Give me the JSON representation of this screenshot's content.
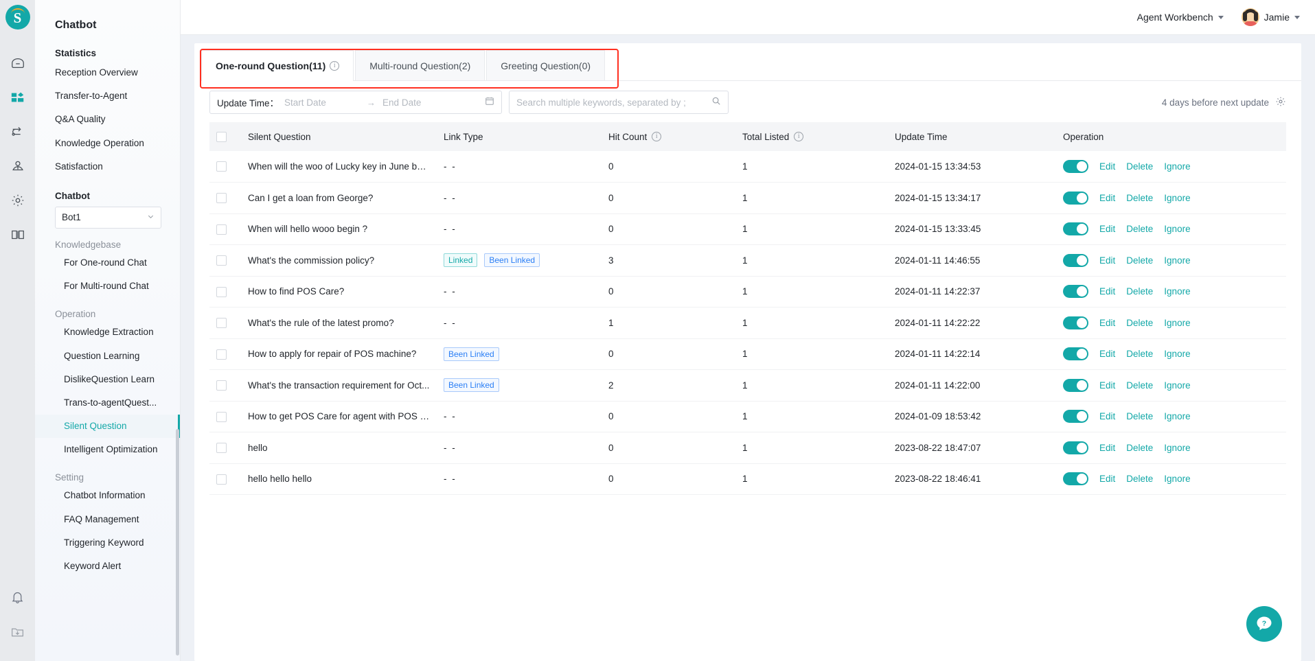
{
  "brand": {
    "logo_letter": "S",
    "accent": "#13a8a8",
    "highlight": "#ff2f20"
  },
  "topbar": {
    "workbench_label": "Agent Workbench",
    "user_name": "Jamie"
  },
  "sidebar": {
    "title": "Chatbot",
    "groups": [
      {
        "label": "Statistics",
        "style": "bold",
        "items": [
          "Reception Overview",
          "Transfer-to-Agent",
          "Q&A Quality",
          "Knowledge Operation",
          "Satisfaction"
        ]
      },
      {
        "label": "Chatbot",
        "style": "bold",
        "select_value": "Bot1",
        "items": []
      },
      {
        "label": "Knowledgebase",
        "style": "muted",
        "items": [
          "For One-round Chat",
          "For Multi-round Chat"
        ]
      },
      {
        "label": "Operation",
        "style": "muted",
        "items": [
          "Knowledge Extraction",
          "Question Learning",
          "DislikeQuestion Learn",
          "Trans-to-agentQuest...",
          "Silent Question",
          "Intelligent Optimization"
        ]
      },
      {
        "label": "Setting",
        "style": "muted",
        "items": [
          "Chatbot Information",
          "FAQ Management",
          "Triggering Keyword",
          "Keyword Alert"
        ]
      }
    ],
    "active_item": "Silent Question"
  },
  "rail_icons": [
    "home-icon",
    "dashboard-icon",
    "transfer-icon",
    "agent-icon",
    "settings-icon",
    "knowledge-book-icon",
    "bell-icon",
    "download-icon"
  ],
  "tabs": [
    {
      "label": "One-round Question(11)",
      "active": true,
      "has_info": true
    },
    {
      "label": "Multi-round Question(2)",
      "active": false,
      "has_info": false
    },
    {
      "label": "Greeting Question(0)",
      "active": false,
      "has_info": false
    }
  ],
  "filters": {
    "update_time_label": "Update Time：",
    "start_date_placeholder": "Start Date",
    "end_date_placeholder": "End Date",
    "range_separator": "→",
    "search_placeholder": "Search multiple keywords, separated by ;",
    "update_note": "4 days before next update"
  },
  "table": {
    "columns": [
      {
        "key": "checkbox",
        "label": ""
      },
      {
        "key": "question",
        "label": "Silent Question",
        "info": false
      },
      {
        "key": "link_type",
        "label": "Link Type",
        "info": false
      },
      {
        "key": "hit_count",
        "label": "Hit Count",
        "info": true
      },
      {
        "key": "total_listed",
        "label": "Total Listed",
        "info": true
      },
      {
        "key": "update_time",
        "label": "Update Time",
        "info": false
      },
      {
        "key": "operation",
        "label": "Operation",
        "info": false
      }
    ],
    "no_link_placeholder": "- -",
    "ops": {
      "edit": "Edit",
      "delete": "Delete",
      "ignore": "Ignore"
    },
    "rows": [
      {
        "question": "When will the woo of Lucky key in June be ...",
        "tags": [],
        "hit_count": "0",
        "total_listed": "1",
        "update_time": "2024-01-15 13:34:53",
        "enabled": true
      },
      {
        "question": "Can I get a loan from George?",
        "tags": [],
        "hit_count": "0",
        "total_listed": "1",
        "update_time": "2024-01-15 13:34:17",
        "enabled": true
      },
      {
        "question": "When will hello wooo begin ?",
        "tags": [],
        "hit_count": "0",
        "total_listed": "1",
        "update_time": "2024-01-15 13:33:45",
        "enabled": true
      },
      {
        "question": "What's the commission policy?",
        "tags": [
          "Linked",
          "Been Linked"
        ],
        "hit_count": "3",
        "total_listed": "1",
        "update_time": "2024-01-11 14:46:55",
        "enabled": true
      },
      {
        "question": "How to find POS Care?",
        "tags": [],
        "hit_count": "0",
        "total_listed": "1",
        "update_time": "2024-01-11 14:22:37",
        "enabled": true
      },
      {
        "question": "What's the rule of the latest promo?",
        "tags": [],
        "hit_count": "1",
        "total_listed": "1",
        "update_time": "2024-01-11 14:22:22",
        "enabled": true
      },
      {
        "question": "How to apply for repair of POS machine?",
        "tags": [
          "Been Linked"
        ],
        "hit_count": "0",
        "total_listed": "1",
        "update_time": "2024-01-11 14:22:14",
        "enabled": true
      },
      {
        "question": "What's the transaction requirement for Oct...",
        "tags": [
          "Been Linked"
        ],
        "hit_count": "2",
        "total_listed": "1",
        "update_time": "2024-01-11 14:22:00",
        "enabled": true
      },
      {
        "question": "How to get POS Care for agent with POS al...",
        "tags": [],
        "hit_count": "0",
        "total_listed": "1",
        "update_time": "2024-01-09 18:53:42",
        "enabled": true
      },
      {
        "question": "hello",
        "tags": [],
        "hit_count": "0",
        "total_listed": "1",
        "update_time": "2023-08-22 18:47:07",
        "enabled": true
      },
      {
        "question": "hello hello hello",
        "tags": [],
        "hit_count": "0",
        "total_listed": "1",
        "update_time": "2023-08-22 18:46:41",
        "enabled": true
      }
    ]
  },
  "help": {
    "label": "?"
  }
}
